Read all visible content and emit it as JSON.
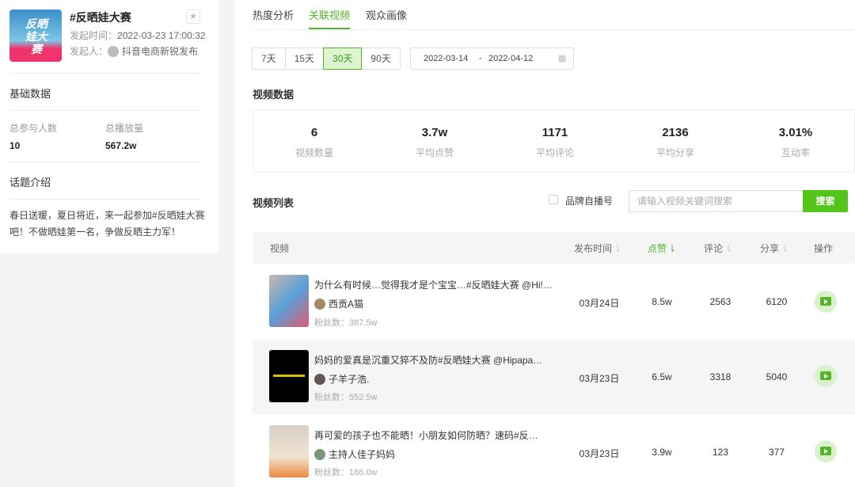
{
  "topic": {
    "cover_text": "反晒娃大赛",
    "title": "#反晒娃大赛",
    "time_label": "发起时间：",
    "time": "2022-03-23 17:00:32",
    "initiator_label": "发起人：",
    "initiator": "抖音电商新锐发布"
  },
  "basic": {
    "heading": "基础数据",
    "participants_label": "总参与人数",
    "participants": "10",
    "plays_label": "总播放量",
    "plays": "567.2w"
  },
  "intro": {
    "heading": "话题介绍",
    "text": "春日送暖，夏日将近，来一起参加#反晒娃大赛吧！不做晒娃第一名，争做反晒主力军！"
  },
  "tabs": [
    "热度分析",
    "关联视频",
    "观众画像"
  ],
  "periods": [
    "7天",
    "15天",
    "30天",
    "90天"
  ],
  "date_range": {
    "start": "2022-03-14",
    "sep": "-",
    "end": "2022-04-12"
  },
  "video_data": {
    "heading": "视频数据",
    "stats": [
      {
        "value": "6",
        "label": "视频数量"
      },
      {
        "value": "3.7w",
        "label": "平均点赞"
      },
      {
        "value": "1171",
        "label": "平均评论"
      },
      {
        "value": "2136",
        "label": "平均分享"
      },
      {
        "value": "3.01%",
        "label": "互动率"
      }
    ]
  },
  "list": {
    "heading": "视频列表",
    "brand_checkbox": "品牌自播号",
    "search_placeholder": "请输入视频关键词搜索",
    "search_button": "搜索",
    "columns": [
      "视频",
      "发布时间",
      "点赞",
      "评论",
      "分享",
      "操作"
    ],
    "rows": [
      {
        "title": "为什么有时候…觉得我才是个宝宝…#反晒娃大赛 @Hi!…",
        "author": "西贡A猫",
        "fans": "粉丝数：387.5w",
        "date": "03月24日",
        "likes": "8.5w",
        "comments": "2563",
        "shares": "6120"
      },
      {
        "title": "妈妈的爱真是沉重又猝不及防#反晒娃大赛 @Hipapa…",
        "author": "子羊子浩.",
        "fans": "粉丝数：552.5w",
        "date": "03月23日",
        "likes": "6.5w",
        "comments": "3318",
        "shares": "5040"
      },
      {
        "title": "再可爱的孩子也不能晒！小朋友如何防晒？速码#反…",
        "author": "主持人佳子妈妈",
        "fans": "粉丝数：186.0w",
        "date": "03月23日",
        "likes": "3.9w",
        "comments": "123",
        "shares": "377"
      }
    ]
  },
  "colors": {
    "accent": "#52c41a"
  }
}
